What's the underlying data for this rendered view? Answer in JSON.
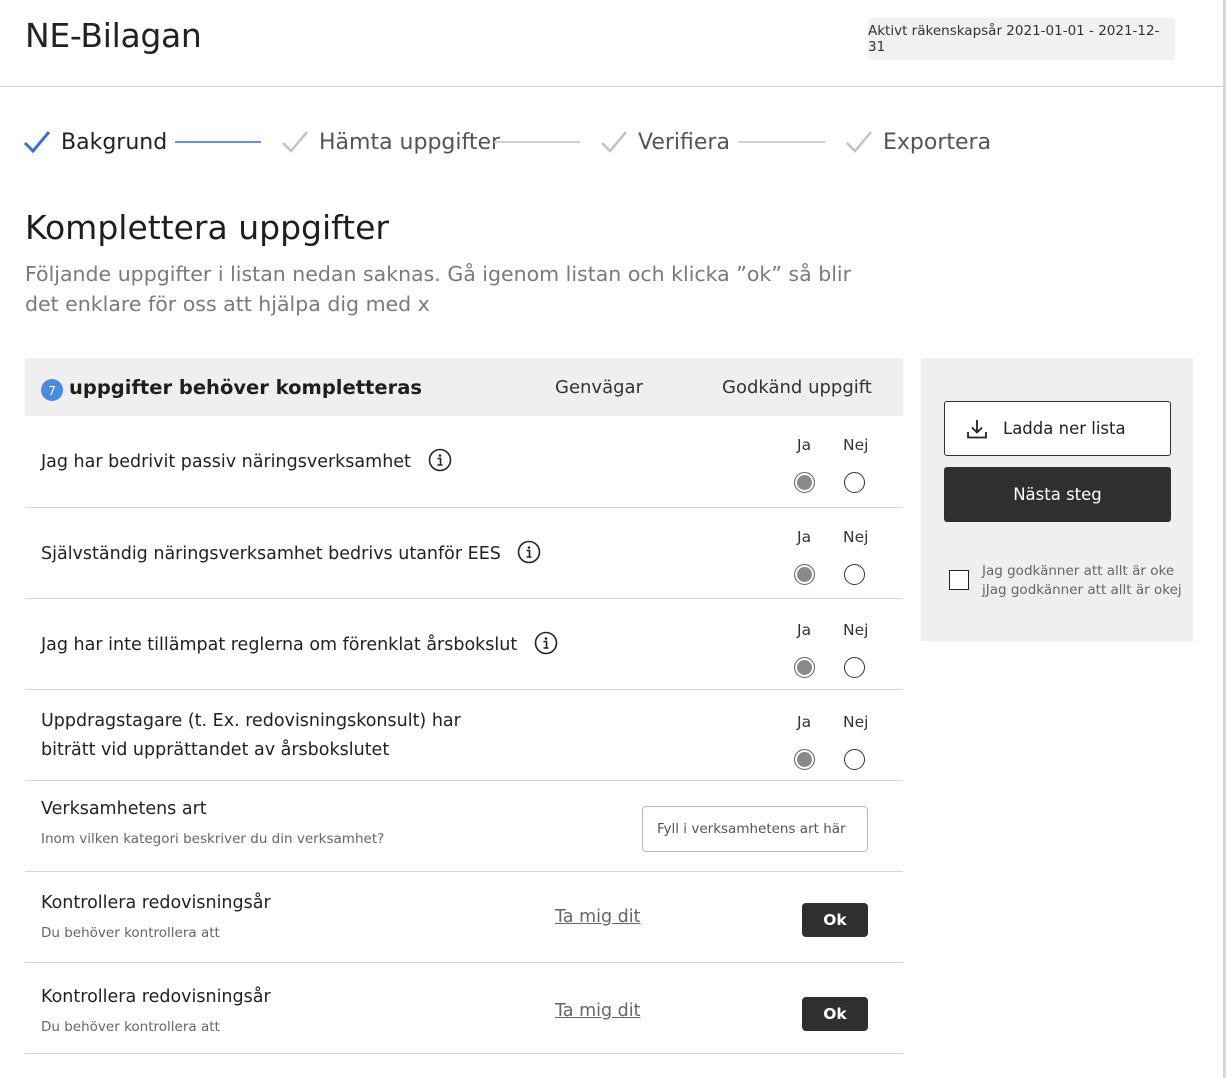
{
  "header": {
    "title": "NE-Bilagan",
    "fiscal_year": "Aktivt räkenskapsår 2021-01-01 - 2021-12-31"
  },
  "stepper": {
    "steps": [
      {
        "label": "Bakgrund",
        "state": "active"
      },
      {
        "label": "Hämta uppgifter",
        "state": "inactive"
      },
      {
        "label": "Verifiera",
        "state": "inactive"
      },
      {
        "label": "Exportera",
        "state": "inactive"
      }
    ]
  },
  "main": {
    "title": "Komplettera uppgifter",
    "description": "Följande uppgifter i listan nedan saknas. Gå igenom listan och klicka ”ok” så blir det enklare för oss att hjälpa dig med x"
  },
  "list": {
    "count": "7",
    "header_title": "uppgifter behöver kompletteras",
    "col_shortcuts": "Genvägar",
    "col_approved": "Godkänd uppgift",
    "yes_label": "Ja",
    "no_label": "Nej",
    "radio_rows": [
      {
        "text": "Jag har bedrivit passiv näringsverksamhet",
        "info": true,
        "selected": "Ja"
      },
      {
        "text": "Självständig näringsverksamhet bedrivs utanför EES",
        "info": true,
        "selected": "Ja"
      },
      {
        "text": "Jag har inte tillämpat reglerna om förenklat årsbokslut",
        "info": true,
        "selected": "Ja"
      },
      {
        "text_line1": "Uppdragstagare (t. Ex. redovisningskonsult) har",
        "text_line2": "biträtt vid upprättandet av årsbokslutet",
        "info": false,
        "selected": "Ja"
      }
    ],
    "input_row": {
      "title": "Verksamhetens art",
      "subtitle": "Inom vilken kategori beskriver du din verksamhet?",
      "placeholder": "Fyll i verksamhetens art här"
    },
    "action_rows": [
      {
        "title": "Kontrollera redovisningsår",
        "subtitle": "Du behöver kontrollera att",
        "link": "Ta mig dit",
        "button": "Ok"
      },
      {
        "title": "Kontrollera redovisningsår",
        "subtitle": "Du behöver kontrollera att",
        "link": "Ta mig dit",
        "button": "Ok"
      }
    ]
  },
  "side_panel": {
    "download_label": "Ladda ner lista",
    "next_label": "Nästa steg",
    "approve_text": "Jag godkänner att allt är oke jJag godkänner att allt är okej"
  },
  "colors": {
    "accent": "#4a8cdc",
    "step_active_line": "#6e8fd8",
    "dark_button": "#2f2f2f",
    "panel_bg": "#efefef"
  }
}
